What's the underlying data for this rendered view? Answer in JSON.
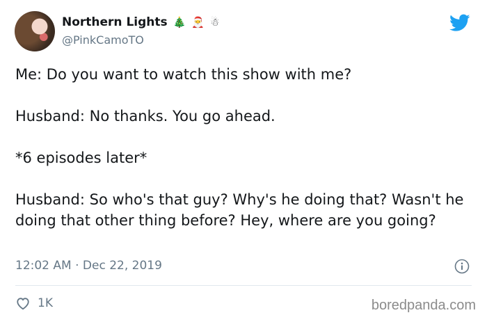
{
  "author": {
    "display_name": "Northern Lights",
    "emojis": [
      "🎄",
      "🎅",
      "☃"
    ],
    "handle": "@PinkCamoTO"
  },
  "tweet": {
    "text": "Me: Do you want to watch this show with me?\n\nHusband: No thanks. You go ahead.\n\n*6 episodes later*\n\nHusband: So who's that guy? Why's he doing that? Wasn't he doing that other thing before? Hey, where are you going?",
    "timestamp": "12:02 AM · Dec 22, 2019"
  },
  "engagement": {
    "likes": "1K"
  },
  "watermark": "boredpanda.com",
  "colors": {
    "brand_blue": "#1da1f2",
    "muted_text": "#657786",
    "divider": "#e1e8ed"
  },
  "icons": {
    "platform": "twitter-bird-icon",
    "info": "info-icon",
    "like": "heart-icon"
  }
}
